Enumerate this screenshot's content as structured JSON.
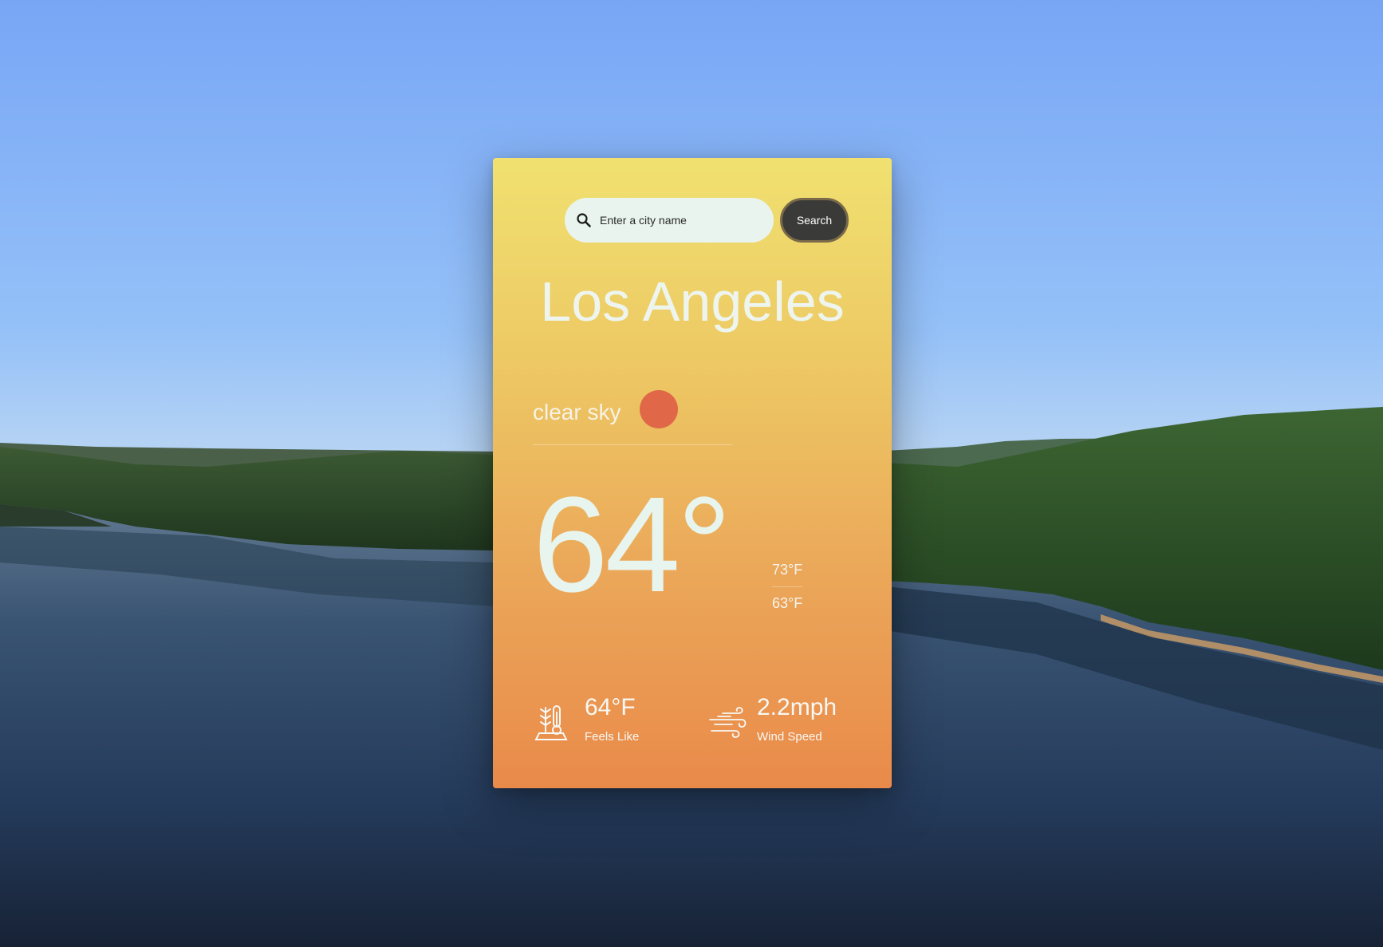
{
  "search": {
    "placeholder": "Enter a city name",
    "button_label": "Search",
    "icon": "search-icon"
  },
  "weather": {
    "city": "Los Angeles",
    "description": "clear sky",
    "condition_icon": "sun-icon",
    "temperature": "64°",
    "temp_high": "73°F",
    "temp_low": "63°F",
    "feels_like": {
      "value": "64°F",
      "label": "Feels Like",
      "icon": "thermometer-icon"
    },
    "wind": {
      "value": "2.2mph",
      "label": "Wind Speed",
      "icon": "wind-icon"
    }
  },
  "colors": {
    "card_top": "#f0e170",
    "card_bottom": "#e98a4a",
    "sun": "#e06848",
    "search_field": "#e9f4ef",
    "search_button": "#3a3b38",
    "text_light": "#eef5ef"
  }
}
